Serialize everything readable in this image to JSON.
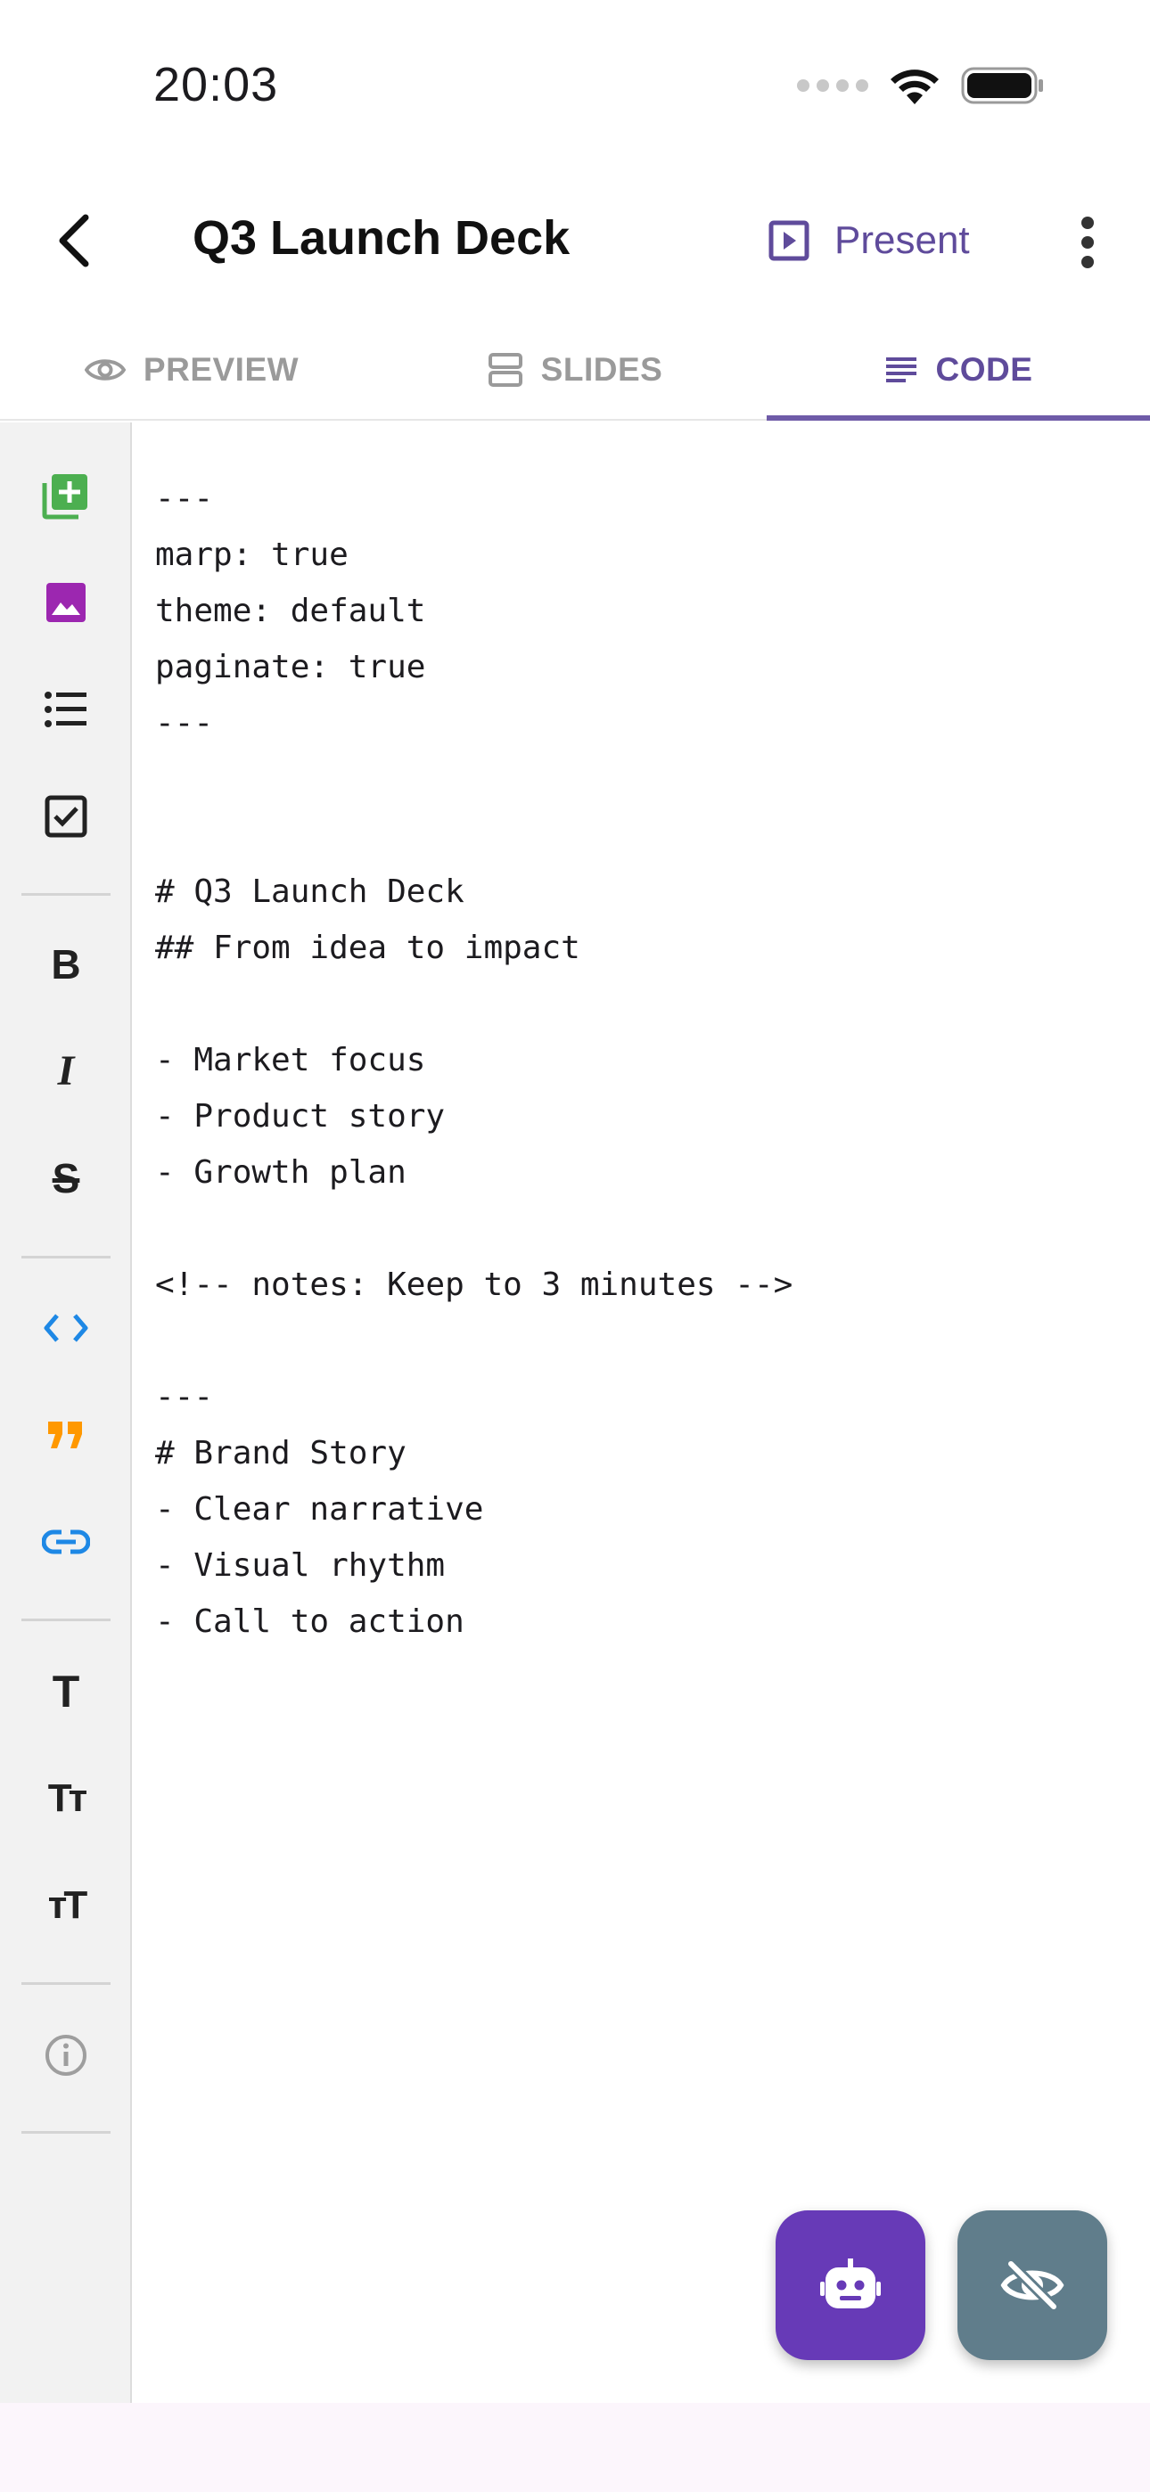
{
  "status_bar": {
    "time": "20:03"
  },
  "app_bar": {
    "title": "Q3 Launch Deck",
    "present_label": "Present"
  },
  "tabs": [
    {
      "label": "PREVIEW",
      "icon": "eye-icon",
      "active": false
    },
    {
      "label": "SLIDES",
      "icon": "slides-icon",
      "active": false
    },
    {
      "label": "CODE",
      "icon": "code-lines-icon",
      "active": true
    }
  ],
  "toolbar": {
    "items": [
      {
        "name": "add-slide-icon",
        "color": "#4caf50"
      },
      {
        "name": "image-icon",
        "color": "#9c27b0"
      },
      {
        "name": "bulleted-list-icon",
        "color": "#222222"
      },
      {
        "name": "checkbox-icon",
        "color": "#222222"
      },
      {
        "name": "bold-icon",
        "label": "B",
        "color": "#222222"
      },
      {
        "name": "italic-icon",
        "label": "I",
        "color": "#222222"
      },
      {
        "name": "strikethrough-icon",
        "label": "S",
        "color": "#222222"
      },
      {
        "name": "code-icon",
        "color": "#1e88e5"
      },
      {
        "name": "quote-icon",
        "color": "#ff9800"
      },
      {
        "name": "link-icon",
        "color": "#1e88e5"
      },
      {
        "name": "heading-icon",
        "label": "T",
        "color": "#222222"
      },
      {
        "name": "text-size-increase-icon",
        "label": "Tт",
        "color": "#222222"
      },
      {
        "name": "text-size-decrease-icon",
        "label": "тT",
        "color": "#222222"
      },
      {
        "name": "info-icon",
        "color": "#9e9e9e"
      }
    ]
  },
  "editor": {
    "lines": [
      "---",
      "marp: true",
      "theme: default",
      "paginate: true",
      "---",
      "",
      "",
      "# Q3 Launch Deck",
      "## From idea to impact",
      "",
      "- Market focus",
      "- Product story",
      "- Growth plan",
      "",
      "<!-- notes: Keep to 3 minutes -->",
      "",
      "---",
      "# Brand Story",
      "- Clear narrative",
      "- Visual rhythm",
      "- Call to action"
    ]
  },
  "fabs": {
    "ai_icon": "robot-icon",
    "hide_icon": "eye-off-icon",
    "ai_color": "#673ab7",
    "hide_color": "#607d8b"
  },
  "colors": {
    "accent": "#5f4b9b",
    "tab_indicator": "#6f5ba8"
  }
}
